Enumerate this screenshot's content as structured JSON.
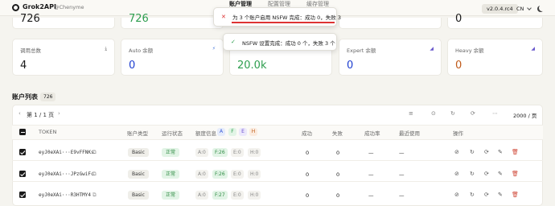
{
  "header": {
    "brand": "Grok2API",
    "handle": "@Chenyme",
    "nav": [
      "账户管理",
      "配置管理",
      "缓存管理"
    ],
    "version": "v2.0.4.rc4",
    "lang": "CN"
  },
  "top_cards": [
    {
      "value": "726",
      "color": "#1a1a1a"
    },
    {
      "value": "726",
      "color": "#2e9e4f"
    },
    {
      "value": "",
      "color": "#1a1a1a"
    },
    {
      "value": "0",
      "color": "#1a1a1a"
    }
  ],
  "stats": [
    {
      "label": "调用总数",
      "value": "4",
      "color": "#1a1a1a",
      "icon": "download-icon"
    },
    {
      "label": "Auto 余额",
      "value": "0",
      "color": "#1f3fd0",
      "icon": "bolt-icon"
    },
    {
      "label": "",
      "value": "20.0k",
      "color": "#2e9e4f",
      "icon": ""
    },
    {
      "label": "Expert 余额",
      "value": "0",
      "color": "#1f3fd0",
      "icon": "chart-icon"
    },
    {
      "label": "Heavy 余额",
      "value": "0",
      "color": "#c05a1a",
      "icon": "chart-icon"
    }
  ],
  "toasts": {
    "error": "为 3 个账户启用 NSFW 完成：成功 0，失败 3",
    "success": "NSFW 设置完成：成功 0 个，失败 3 个"
  },
  "list": {
    "title": "账户列表",
    "count": "726",
    "page_label": "第 1 / 1 页",
    "per_page": "2000 / 页"
  },
  "columns": {
    "token": "TOKEN",
    "type": "账户类型",
    "status": "运行状态",
    "quota": "额度信息",
    "quota_tags": [
      "A",
      "F",
      "E",
      "H"
    ],
    "success": "成功",
    "fail": "失败",
    "rate": "成功率",
    "last_used": "最近使用",
    "actions": "操作"
  },
  "rows": [
    {
      "token": "eyJ0eXAi···E9vFFNKs",
      "type": "Basic",
      "status": "正常",
      "q": [
        "A:0",
        "F:26",
        "E:0",
        "H:0"
      ],
      "success": "0",
      "fail": "0",
      "rate": "—",
      "last": "—"
    },
    {
      "token": "eyJ0eXAi···JPzGwiFc",
      "type": "Basic",
      "status": "正常",
      "q": [
        "A:0",
        "F:26",
        "E:0",
        "H:0"
      ],
      "success": "0",
      "fail": "0",
      "rate": "—",
      "last": "—"
    },
    {
      "token": "eyJ0eXAi···R3HTMY4",
      "type": "Basic",
      "status": "正常",
      "q": [
        "A:0",
        "F:27",
        "E:0",
        "H:0"
      ],
      "success": "0",
      "fail": "0",
      "rate": "—",
      "last": "—"
    }
  ]
}
